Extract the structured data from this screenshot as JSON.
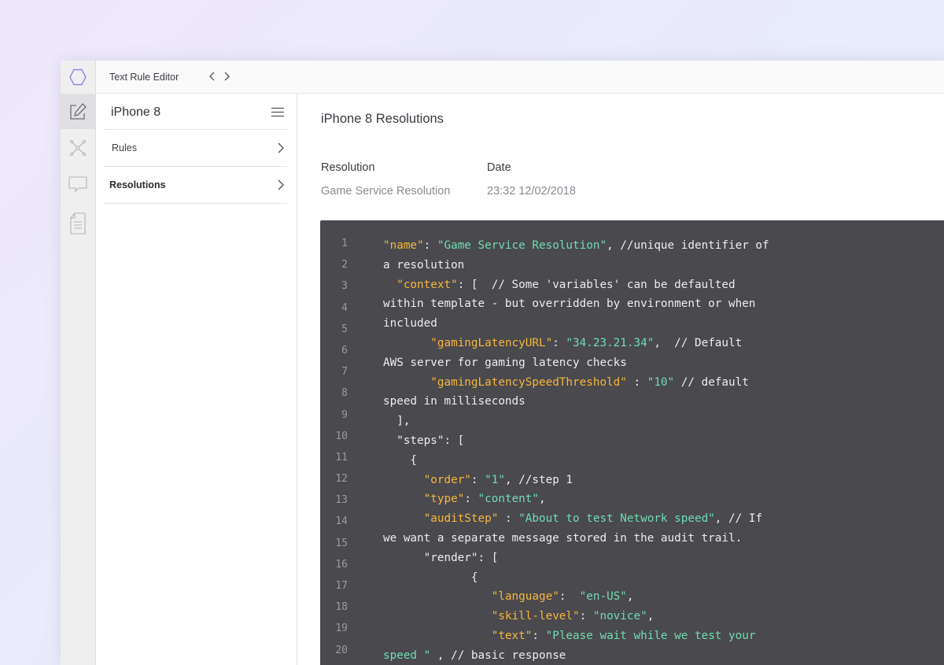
{
  "app": {
    "title": "Text Rule Editor"
  },
  "icons": {
    "logo": "hexagon-icon",
    "rail": [
      "edit-icon",
      "network-icon",
      "comment-icon",
      "document-icon"
    ],
    "back": "chevron-left-icon",
    "forward": "chevron-right-icon",
    "menu": "hamburger-menu-icon",
    "item_arrow": "chevron-right-icon"
  },
  "colors": {
    "code_bg": "#4a494e",
    "key": "#f5b63c",
    "string": "#6fdcb0",
    "accent": "#7b7be0"
  },
  "sidebar": {
    "device": "iPhone 8",
    "items": [
      {
        "label": "Rules",
        "active": false
      },
      {
        "label": "Resolutions",
        "active": true
      }
    ]
  },
  "main": {
    "title": "iPhone 8 Resolutions",
    "columns": [
      {
        "header": "Resolution",
        "value": "Game Service Resolution"
      },
      {
        "header": "Date",
        "value": "23:32 12/02/2018"
      }
    ]
  },
  "code": {
    "line_numbers": [
      "1",
      "2",
      "3",
      "4",
      "5",
      "6",
      "7",
      "8",
      "9",
      "10",
      "11",
      "12",
      "13",
      "14",
      "15",
      "16",
      "17",
      "18",
      "19",
      "20"
    ],
    "lines": [
      [
        {
          "t": "k",
          "v": "\"name\""
        },
        {
          "t": "p",
          "v": ": "
        },
        {
          "t": "s",
          "v": "\"Game Service Resolution\""
        },
        {
          "t": "p",
          "v": ", //unique identifier of"
        }
      ],
      [
        {
          "t": "p",
          "v": "a resolution"
        }
      ],
      [
        {
          "t": "p",
          "v": "  "
        },
        {
          "t": "k",
          "v": "\"context\""
        },
        {
          "t": "p",
          "v": ": [  // Some 'variables' can be defaulted"
        }
      ],
      [
        {
          "t": "p",
          "v": "within template - but overridden by environment or when"
        }
      ],
      [
        {
          "t": "p",
          "v": "included"
        }
      ],
      [
        {
          "t": "p",
          "v": "       "
        },
        {
          "t": "k",
          "v": "\"gamingLatencyURL\""
        },
        {
          "t": "p",
          "v": ": "
        },
        {
          "t": "s",
          "v": "\"34.23.21.34\""
        },
        {
          "t": "p",
          "v": ",  // Default"
        }
      ],
      [
        {
          "t": "p",
          "v": "AWS server for gaming latency checks"
        }
      ],
      [
        {
          "t": "p",
          "v": "       "
        },
        {
          "t": "k",
          "v": "\"gamingLatencySpeedThreshold\""
        },
        {
          "t": "p",
          "v": " : "
        },
        {
          "t": "s",
          "v": "\"10\""
        },
        {
          "t": "p",
          "v": " // default"
        }
      ],
      [
        {
          "t": "p",
          "v": "speed in milliseconds"
        }
      ],
      [
        {
          "t": "p",
          "v": "  ],"
        }
      ],
      [
        {
          "t": "p",
          "v": "  \"steps\": ["
        }
      ],
      [
        {
          "t": "p",
          "v": "    {"
        }
      ],
      [
        {
          "t": "p",
          "v": "      "
        },
        {
          "t": "k",
          "v": "\"order\""
        },
        {
          "t": "p",
          "v": ": "
        },
        {
          "t": "s",
          "v": "\"1\""
        },
        {
          "t": "p",
          "v": ", //step 1"
        }
      ],
      [
        {
          "t": "p",
          "v": "      "
        },
        {
          "t": "k",
          "v": "\"type\""
        },
        {
          "t": "p",
          "v": ": "
        },
        {
          "t": "s",
          "v": "\"content\""
        },
        {
          "t": "p",
          "v": ","
        }
      ],
      [
        {
          "t": "p",
          "v": "      "
        },
        {
          "t": "k",
          "v": "\"auditStep\""
        },
        {
          "t": "p",
          "v": " : "
        },
        {
          "t": "s",
          "v": "\"About to test Network speed\""
        },
        {
          "t": "p",
          "v": ", // If"
        }
      ],
      [
        {
          "t": "p",
          "v": "we want a separate message stored in the audit trail."
        }
      ],
      [
        {
          "t": "p",
          "v": "      \"render\": ["
        }
      ],
      [
        {
          "t": "p",
          "v": "             {"
        }
      ],
      [
        {
          "t": "p",
          "v": "                "
        },
        {
          "t": "k",
          "v": "\"language\""
        },
        {
          "t": "p",
          "v": ":  "
        },
        {
          "t": "s",
          "v": "\"en-US\""
        },
        {
          "t": "p",
          "v": ","
        }
      ],
      [
        {
          "t": "p",
          "v": "                "
        },
        {
          "t": "k",
          "v": "\"skill-level\""
        },
        {
          "t": "p",
          "v": ": "
        },
        {
          "t": "s",
          "v": "\"novice\""
        },
        {
          "t": "p",
          "v": ","
        }
      ],
      [
        {
          "t": "p",
          "v": "                "
        },
        {
          "t": "k",
          "v": "\"text\""
        },
        {
          "t": "p",
          "v": ": "
        },
        {
          "t": "s",
          "v": "\"Please wait while we test your"
        }
      ],
      [
        {
          "t": "s",
          "v": "speed \""
        },
        {
          "t": "p",
          "v": " , // basic response"
        }
      ]
    ]
  }
}
